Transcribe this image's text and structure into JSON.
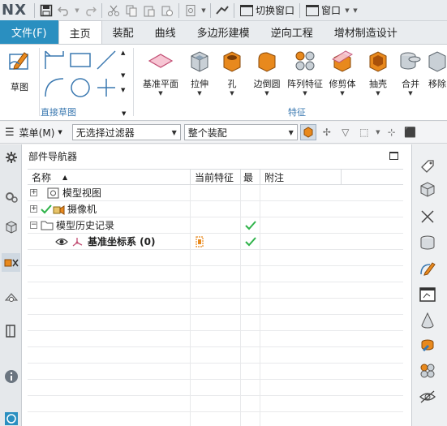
{
  "titlebar": {
    "logo": "NX",
    "switch_window": "切换窗口",
    "window_menu": "窗口"
  },
  "tabs": [
    "文件(F)",
    "主页",
    "装配",
    "曲线",
    "多边形建模",
    "逆向工程",
    "增材制造设计"
  ],
  "active_tab": "主页",
  "ribbon": {
    "sketch_label": "草图",
    "direct_sketch_group": "直接草图",
    "feature_group": "特征",
    "features": [
      {
        "label": "基准平面",
        "icon": "datum-plane-icon"
      },
      {
        "label": "拉伸",
        "icon": "extrude-icon"
      },
      {
        "label": "孔",
        "icon": "hole-icon"
      },
      {
        "label": "边倒圆",
        "icon": "edge-blend-icon"
      },
      {
        "label": "阵列特征",
        "icon": "pattern-feature-icon"
      },
      {
        "label": "修剪体",
        "icon": "trim-body-icon"
      },
      {
        "label": "抽壳",
        "icon": "shell-icon"
      },
      {
        "label": "合并",
        "icon": "unite-icon"
      },
      {
        "label": "移除",
        "icon": "remove-icon"
      }
    ]
  },
  "selection_bar": {
    "menu_label": "菜单(M)",
    "filter_value": "无选择过滤器",
    "scope_value": "整个装配"
  },
  "navigator": {
    "title": "部件导航器",
    "columns": [
      "名称",
      "当前特征",
      "最",
      "附注"
    ],
    "rows": [
      {
        "name": "模型视图",
        "expander": "+",
        "check": false,
        "latest": false
      },
      {
        "name": "摄像机",
        "expander": "+",
        "check": true,
        "latest": false
      },
      {
        "name": "模型历史记录",
        "expander": "−",
        "check": false,
        "latest": true
      },
      {
        "name": "基准坐标系 (0)",
        "expander": "",
        "check": false,
        "latest": true,
        "bold": true,
        "current": true
      }
    ]
  },
  "colors": {
    "file_tab": "#2a8fc0",
    "accent_orange": "#e8891d",
    "check_green": "#2fb34a",
    "group_label_blue": "#3a78b0"
  }
}
